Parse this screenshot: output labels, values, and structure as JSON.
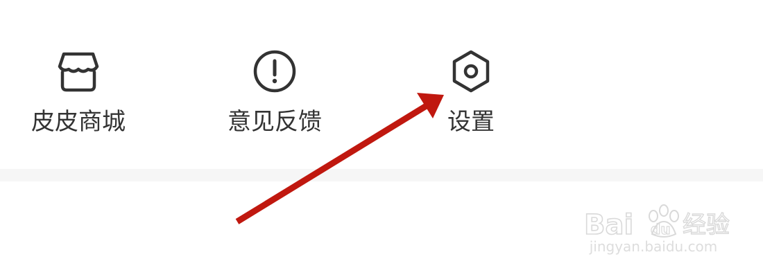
{
  "menu": {
    "items": [
      {
        "label": "皮皮商城",
        "icon": "store-icon"
      },
      {
        "label": "意见反馈",
        "icon": "exclamation-circle-icon"
      },
      {
        "label": "设置",
        "icon": "settings-hexagon-icon"
      }
    ]
  },
  "annotation": {
    "color": "#c0180f"
  },
  "watermark": {
    "logo_text": "Baidu经验",
    "url": "jingyan.baidu.com"
  },
  "colors": {
    "text": "#333333",
    "icon": "#333333",
    "divider": "#f6f6f6",
    "watermark": "#dddddd"
  }
}
